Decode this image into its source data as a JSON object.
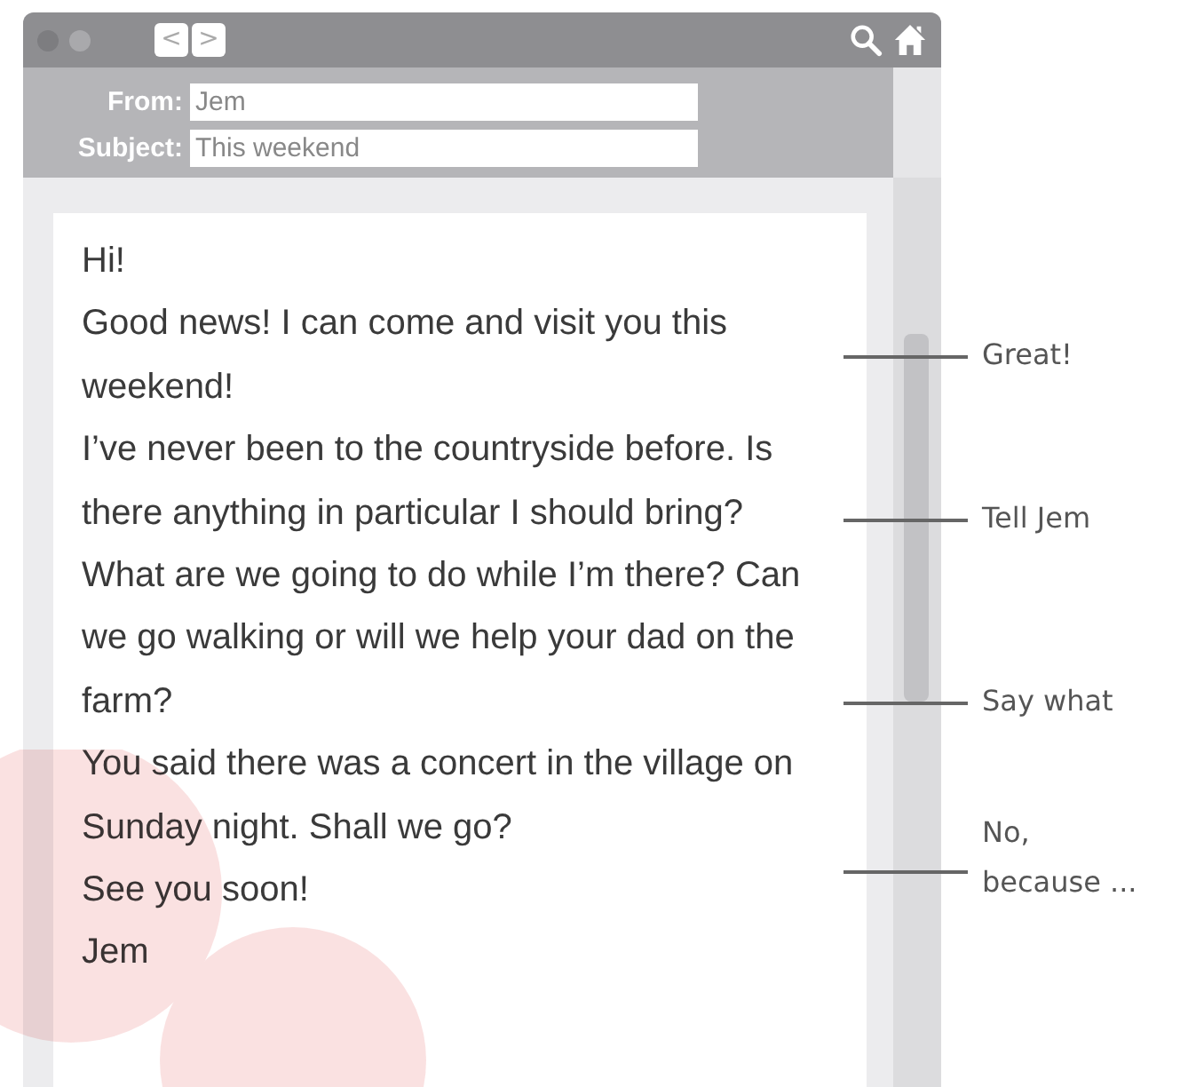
{
  "toolbar": {
    "back": "<",
    "forward": ">"
  },
  "header": {
    "fields": [
      {
        "label": "From:",
        "value": "Jem"
      },
      {
        "label": "Subject:",
        "value": "This weekend"
      }
    ]
  },
  "message": {
    "paragraphs": [
      "Hi!",
      "Good news! I can come and visit you this weekend!",
      "I’ve never been to the countryside before. Is there anything in particular I should bring?",
      "What are we going to do while I’m there? Can we go walking or will we help your dad on the farm?",
      "You said there was a concert in the village on Sunday night. Shall we go?",
      "See you soon!",
      "Jem"
    ]
  },
  "notes": [
    {
      "text": "Great!"
    },
    {
      "text": "Tell Jem"
    },
    {
      "text": "Say what"
    },
    {
      "text": "No,\nbecause ..."
    }
  ]
}
